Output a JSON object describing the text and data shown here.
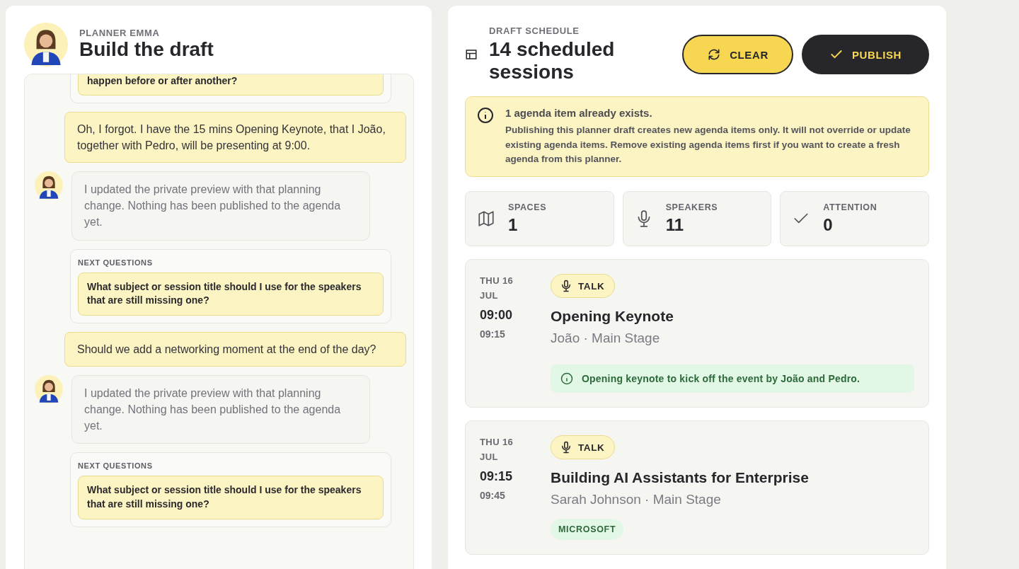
{
  "planner": {
    "eyebrow": "PLANNER EMMA",
    "title": "Build the draft"
  },
  "chat": [
    {
      "kind": "questions",
      "cut_off": true,
      "questions": [
        "happen before or after another?"
      ]
    },
    {
      "kind": "user",
      "text": "Oh, I forgot. I have the 15 mins Opening Keynote, that I João, together with Pedro, will be presenting at 9:00."
    },
    {
      "kind": "assistant",
      "text": "I updated the private preview with that planning change. Nothing has been published to the agenda yet."
    },
    {
      "kind": "questions",
      "cut_off": false,
      "label": "NEXT QUESTIONS",
      "questions": [
        "What subject or session title should I use for the speakers that are still missing one?"
      ]
    },
    {
      "kind": "user",
      "text": "Should we add a networking moment at the end of the day?"
    },
    {
      "kind": "assistant",
      "text": "I updated the private preview with that planning change. Nothing has been published to the agenda yet."
    },
    {
      "kind": "questions",
      "cut_off": false,
      "label": "NEXT QUESTIONS",
      "questions": [
        "What subject or session title should I use for the speakers that are still missing one?"
      ]
    }
  ],
  "schedule": {
    "eyebrow": "DRAFT SCHEDULE",
    "title": "14 scheduled sessions",
    "buttons": [
      {
        "kind": "clear",
        "label": "CLEAR"
      },
      {
        "kind": "publish",
        "label": "PUBLISH"
      }
    ]
  },
  "notice": {
    "title": "1 agenda item already exists.",
    "body": "Publishing this planner draft creates new agenda items only. It will not override or update existing agenda items. Remove existing agenda items first if you want to create a fresh agenda from this planner."
  },
  "stats": [
    {
      "kind": "spaces",
      "label": "SPACES",
      "value": "1"
    },
    {
      "kind": "speakers",
      "label": "SPEAKERS",
      "value": "11"
    },
    {
      "kind": "attention",
      "label": "ATTENTION",
      "value": "0"
    }
  ],
  "sessions": [
    {
      "date": "THU 16 JUL",
      "start": "09:00",
      "end": "09:15",
      "type": "TALK",
      "title": "Opening Keynote",
      "meta": "João · Main Stage",
      "note": "Opening keynote to kick off the event by João and Pedro."
    },
    {
      "date": "THU 16 JUL",
      "start": "09:15",
      "end": "09:45",
      "type": "TALK",
      "title": "Building AI Assistants for Enterprise",
      "meta": "Sarah Johnson · Main Stage",
      "tags": [
        "MICROSOFT"
      ]
    }
  ]
}
